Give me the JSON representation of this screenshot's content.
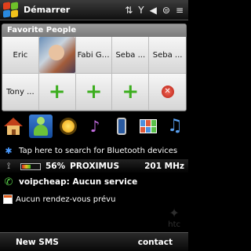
{
  "statusbar": {
    "title": "Démarrer"
  },
  "favorites": {
    "header": "Favorite People",
    "row1": [
      "Eric",
      "",
      "Fabi Gsm",
      "Seba ...",
      "Seba ..."
    ],
    "row2_name": "Tony ..."
  },
  "bluetooth": {
    "text": "Tap here to search for Bluetooth devices"
  },
  "status": {
    "battery_percent": "56%",
    "battery_level": 0.56,
    "operator": "PROXIMUS",
    "cpu": "201 MHz"
  },
  "voip": {
    "text": "voipcheap: Aucun service"
  },
  "calendar": {
    "text": "Aucun rendez-vous prévu"
  },
  "softkeys": {
    "left": "New SMS",
    "right": "contact"
  },
  "watermark": "htc"
}
